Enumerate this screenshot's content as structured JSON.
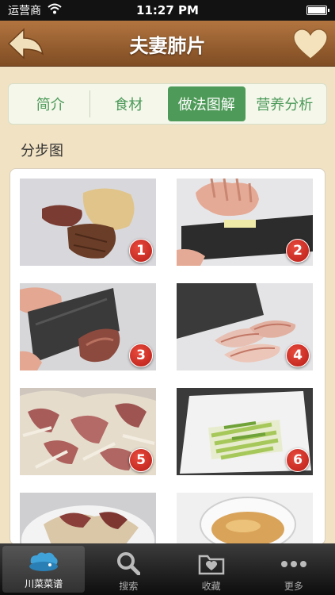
{
  "status_bar": {
    "carrier": "运营商",
    "time": "11:27 PM"
  },
  "nav": {
    "title": "夫妻肺片",
    "back_icon": "arrow-left-icon",
    "fav_icon": "heart-icon"
  },
  "segments": [
    {
      "label": "简介",
      "active": false
    },
    {
      "label": "食材",
      "active": false
    },
    {
      "label": "做法图解",
      "active": true
    },
    {
      "label": "营养分析",
      "active": false
    }
  ],
  "section_title": "分步图",
  "steps": [
    {
      "number": "1"
    },
    {
      "number": "2"
    },
    {
      "number": "3"
    },
    {
      "number": "4"
    },
    {
      "number": "5"
    },
    {
      "number": "6"
    },
    {
      "number": ""
    },
    {
      "number": ""
    }
  ],
  "tabs": [
    {
      "label": "川菜菜谱",
      "icon": "chef-hat-icon",
      "active": true
    },
    {
      "label": "搜索",
      "icon": "magnifier-icon",
      "active": false
    },
    {
      "label": "收藏",
      "icon": "folder-heart-icon",
      "active": false
    },
    {
      "label": "更多",
      "icon": "more-dots-icon",
      "active": false
    }
  ],
  "colors": {
    "accent_green": "#4e9a58",
    "nav_brown": "#9a6232",
    "badge_red": "#c9271f"
  }
}
